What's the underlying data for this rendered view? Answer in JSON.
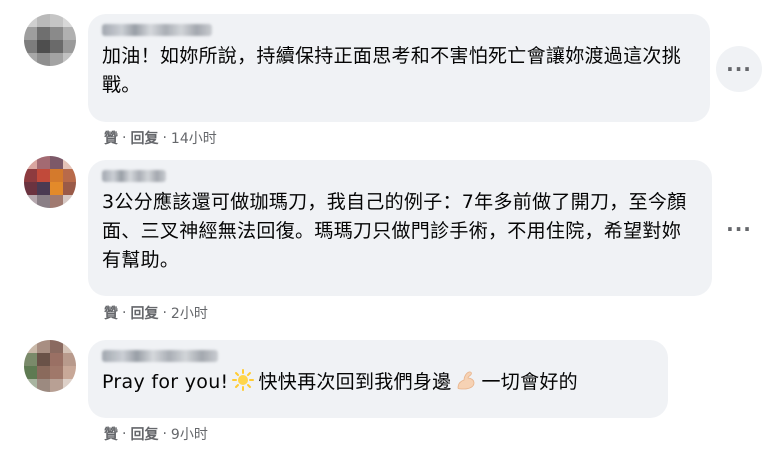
{
  "comments": [
    {
      "text": "加油！如妳所說，持續保持正面思考和不害怕死亡會讓妳渡過這次挑戰。",
      "like": "贊",
      "reply": "回复",
      "time": "14小时"
    },
    {
      "text": "3公分應該還可做珈瑪刀，我自己的例子：7年多前做了開刀，至今顏面、三叉神經無法回復。瑪瑪刀只做門診手術，不用住院，希望對妳有幫助。",
      "like": "贊",
      "reply": "回复",
      "time": "2小时"
    },
    {
      "text_part1": "Pray for you!",
      "text_part2": "快快再次回到我們身邊",
      "text_part3": "一切會好的",
      "emoji1": "sparkle-sun-icon",
      "emoji2": "flexed-biceps-icon",
      "like": "贊",
      "reply": "回复",
      "time": "9小时"
    }
  ],
  "more_label": "···",
  "separator": "·"
}
